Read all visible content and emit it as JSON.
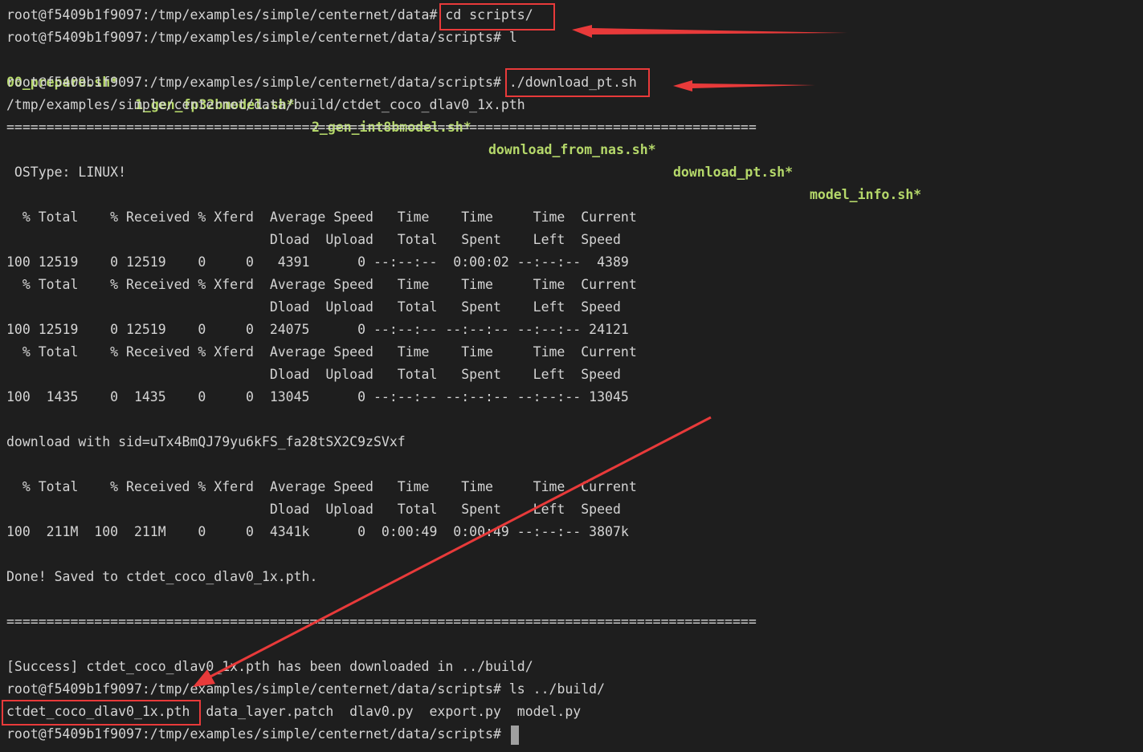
{
  "terminal": {
    "lines": [
      {
        "prompt": "root@f5409b1f9097:/tmp/examples/simple/centernet/data#",
        "cmd": " cd scripts/"
      },
      {
        "prompt": "root@f5409b1f9097:/tmp/examples/simple/centernet/data/scripts#",
        "cmd": " l"
      },
      {
        "files": [
          "00_prepare.sh*",
          "1_gen_fp32bmodel.sh*",
          "2_gen_int8bmodel.sh*",
          "download_from_nas.sh*",
          "download_pt.sh*",
          "model_info.sh*"
        ]
      },
      {
        "prompt": "root@f5409b1f9097:/tmp/examples/simple/centernet/data/scripts#",
        "cmd": " ./download_pt.sh"
      },
      {
        "text": "/tmp/examples/simple/centernet/data/build/ctdet_coco_dlav0_1x.pth"
      },
      {
        "text": "=============================================================================================="
      },
      {
        "text": ""
      },
      {
        "text": " OSType: LINUX!"
      },
      {
        "text": ""
      },
      {
        "text": "  % Total    % Received % Xferd  Average Speed   Time    Time     Time  Current"
      },
      {
        "text": "                                 Dload  Upload   Total   Spent    Left  Speed"
      },
      {
        "text": "100 12519    0 12519    0     0   4391      0 --:--:--  0:00:02 --:--:--  4389"
      },
      {
        "text": "  % Total    % Received % Xferd  Average Speed   Time    Time     Time  Current"
      },
      {
        "text": "                                 Dload  Upload   Total   Spent    Left  Speed"
      },
      {
        "text": "100 12519    0 12519    0     0  24075      0 --:--:-- --:--:-- --:--:-- 24121"
      },
      {
        "text": "  % Total    % Received % Xferd  Average Speed   Time    Time     Time  Current"
      },
      {
        "text": "                                 Dload  Upload   Total   Spent    Left  Speed"
      },
      {
        "text": "100  1435    0  1435    0     0  13045      0 --:--:-- --:--:-- --:--:-- 13045"
      },
      {
        "text": ""
      },
      {
        "text": "download with sid=uTx4BmQJ79yu6kFS_fa28tSX2C9zSVxf"
      },
      {
        "text": ""
      },
      {
        "text": "  % Total    % Received % Xferd  Average Speed   Time    Time     Time  Current"
      },
      {
        "text": "                                 Dload  Upload   Total   Spent    Left  Speed"
      },
      {
        "text": "100  211M  100  211M    0     0  4341k      0  0:00:49  0:00:49 --:--:-- 3807k"
      },
      {
        "text": ""
      },
      {
        "text": "Done! Saved to ctdet_coco_dlav0_1x.pth."
      },
      {
        "text": ""
      },
      {
        "text": "=============================================================================================="
      },
      {
        "text": ""
      },
      {
        "text": "[Success] ctdet_coco_dlav0_1x.pth has been downloaded in ../build/"
      },
      {
        "prompt": "root@f5409b1f9097:/tmp/examples/simple/centernet/data/scripts#",
        "cmd": " ls ../build/"
      },
      {
        "text": "ctdet_coco_dlav0_1x.pth  data_layer.patch  dlav0.py  export.py  model.py"
      },
      {
        "prompt": "root@f5409b1f9097:/tmp/examples/simple/centernet/data/scripts#",
        "cmd": " "
      }
    ]
  },
  "colors": {
    "background": "#1e1e1e",
    "text": "#d4d4d4",
    "executable": "#b5d86a",
    "annotation": "#e83a3a"
  }
}
